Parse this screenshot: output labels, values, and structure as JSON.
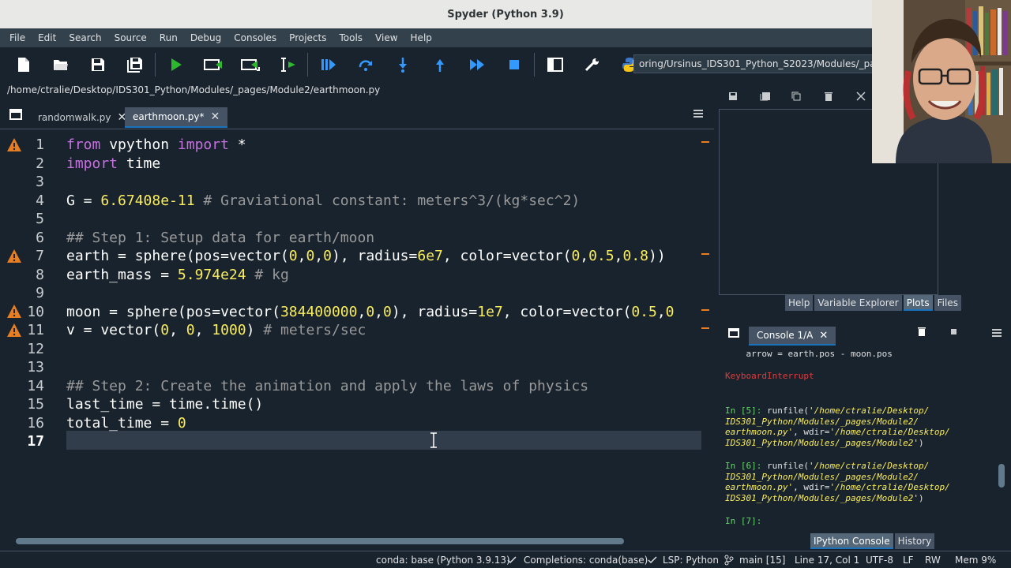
{
  "window": {
    "title": "Spyder (Python 3.9)"
  },
  "menu": [
    "File",
    "Edit",
    "Search",
    "Source",
    "Run",
    "Debug",
    "Consoles",
    "Projects",
    "Tools",
    "View",
    "Help"
  ],
  "toolbar": {
    "working_dir": "oring/Ursinus_IDS301_Python_S2023/Modules/_pages/M",
    "buttons": [
      "new-file",
      "open-file",
      "save-file",
      "save-all",
      "run",
      "run-cell",
      "run-cell-advance",
      "run-selection",
      "debug",
      "step",
      "step-into",
      "step-return",
      "continue",
      "stop",
      "maximize-pane",
      "preferences",
      "python-path"
    ]
  },
  "editor": {
    "path": "/home/ctralie/Desktop/IDS301_Python/Modules/_pages/Module2/earthmoon.py",
    "tabs": [
      {
        "label": "randomwalk.py",
        "active": false
      },
      {
        "label": "earthmoon.py*",
        "active": true
      }
    ],
    "line_numbers": [
      "1",
      "2",
      "3",
      "4",
      "5",
      "6",
      "7",
      "8",
      "9",
      "10",
      "11",
      "12",
      "13",
      "14",
      "15",
      "16",
      "17"
    ],
    "lines": {
      "l1": {
        "k1": "from",
        "n1": " vpython ",
        "k2": "import",
        "n2": " *"
      },
      "l2": {
        "k1": "import",
        "n1": " time"
      },
      "l4": {
        "n1": "G = ",
        "num1": "6.67408e-11",
        "c1": " # Graviational constant: meters^3/(kg*sec^2)"
      },
      "l6": {
        "c1": "## Step 1: Setup data for earth/moon"
      },
      "l7": {
        "n1": "earth = sphere(pos=vector(",
        "num1": "0",
        "n2": ",",
        "num2": "0",
        "n3": ",",
        "num3": "0",
        "n4": "), radius=",
        "num4": "6e7",
        "n5": ", color=vector(",
        "num5": "0",
        "n6": ",",
        "num6": "0.5",
        "n7": ",",
        "num7": "0.8",
        "n8": "))"
      },
      "l8": {
        "n1": "earth_mass = ",
        "num1": "5.974e24",
        "c1": " # kg"
      },
      "l10": {
        "n1": "moon = sphere(pos=vector(",
        "num1": "384400000",
        "n2": ",",
        "num2": "0",
        "n3": ",",
        "num3": "0",
        "n4": "), radius=",
        "num4": "1e7",
        "n5": ", color=vector(",
        "num5": "0.5",
        "n6": ",",
        "num6": "0"
      },
      "l11": {
        "n1": "v = vector(",
        "num1": "0",
        "n2": ", ",
        "num2": "0",
        "n3": ", ",
        "num3": "1000",
        "n4": ")",
        "c1": " # meters/sec"
      },
      "l14": {
        "c1": "## Step 2: Create the animation and apply the laws of physics"
      },
      "l15": {
        "n1": "last_time = time.time()"
      },
      "l16": {
        "n1": "total_time = ",
        "num1": "0"
      }
    }
  },
  "plots_pane": {
    "tabs": [
      "Help",
      "Variable Explorer",
      "Plots",
      "Files"
    ],
    "active_tab": "Plots"
  },
  "console": {
    "tab_label": "Console 1/A",
    "lines": {
      "a1": "    arrow = earth.pos - moon.pos",
      "a2": "KeyboardInterrupt",
      "p5": "In [5]:",
      "r5a": " runfile(",
      "r5s1": "'/home/ctralie/Desktop/",
      "r5s2": "IDS301_Python/Modules/_pages/Module2/",
      "r5s3": "earthmoon.py'",
      "r5b": ", wdir=",
      "r5s4": "'/home/ctralie/Desktop/",
      "r5s5": "IDS301_Python/Modules/_pages/Module2'",
      "r5c": ")",
      "p6": "In [6]:",
      "p7": "In [7]:"
    },
    "bottom_tabs": [
      "IPython Console",
      "History"
    ],
    "active_bottom_tab": "IPython Console"
  },
  "statusbar": {
    "conda": "conda: base (Python 3.9.13)",
    "completions": "Completions: conda(base)",
    "lsp": "LSP: Python",
    "git": "main [15]",
    "position": "Line 17, Col 1",
    "encoding": "UTF-8",
    "eol": "LF",
    "rw": "RW",
    "mem": "Mem  9%"
  },
  "colors": {
    "background": "#19232d",
    "keyword": "#c670e0",
    "number": "#faed5c",
    "comment": "#999999",
    "accent": "#1a72bb",
    "warning": "#e77e22"
  }
}
